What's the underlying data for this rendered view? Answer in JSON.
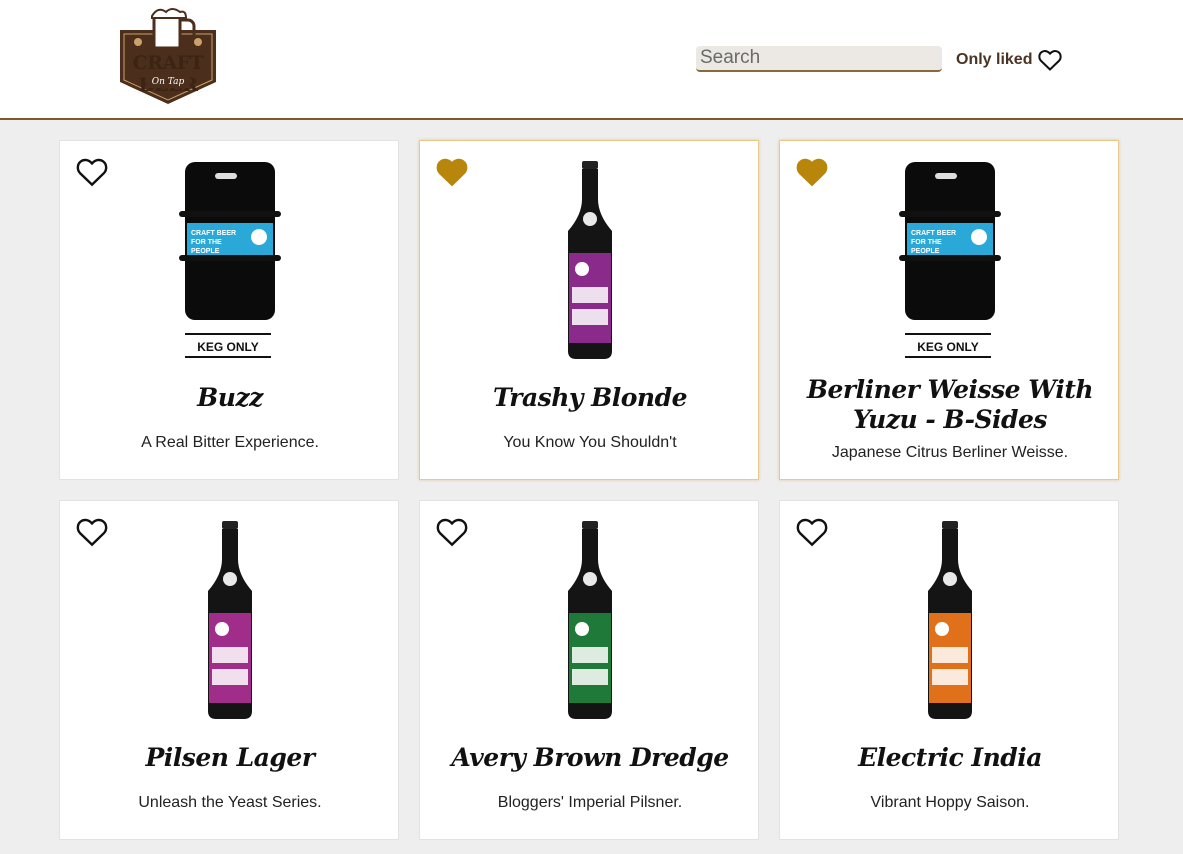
{
  "header": {
    "logo_line1": "CRAFT BEER",
    "logo_line2": "On Tap",
    "search_placeholder": "Search",
    "only_liked_label": "Only liked"
  },
  "colors": {
    "accent": "#b8860b",
    "header_border": "#7a5a2a",
    "brown": "#4a3425"
  },
  "beers": [
    {
      "name": "Buzz",
      "tagline": "A Real Bitter Experience.",
      "liked": false,
      "image": "keg",
      "label_color": "#2aa8d8"
    },
    {
      "name": "Trashy Blonde",
      "tagline": "You Know You Shouldn't",
      "liked": true,
      "image": "bottle",
      "label_color": "#8a2a8a"
    },
    {
      "name": "Berliner Weisse With Yuzu - B-Sides",
      "tagline": "Japanese Citrus Berliner Weisse.",
      "liked": true,
      "image": "keg",
      "label_color": "#2aa8d8"
    },
    {
      "name": "Pilsen Lager",
      "tagline": "Unleash the Yeast Series.",
      "liked": false,
      "image": "bottle",
      "label_color": "#a02d8a"
    },
    {
      "name": "Avery Brown Dredge",
      "tagline": "Bloggers' Imperial Pilsner.",
      "liked": false,
      "image": "bottle",
      "label_color": "#1f7a3a"
    },
    {
      "name": "Electric India",
      "tagline": "Vibrant Hoppy Saison.",
      "liked": false,
      "image": "bottle",
      "label_color": "#e0701a"
    }
  ],
  "keg_label": {
    "line1": "CRAFT BEER",
    "line2": "FOR THE",
    "line3": "PEOPLE",
    "keg_only": "KEG ONLY"
  },
  "icons": {
    "heart": "heart-icon",
    "logo": "beer-mug-logo"
  }
}
